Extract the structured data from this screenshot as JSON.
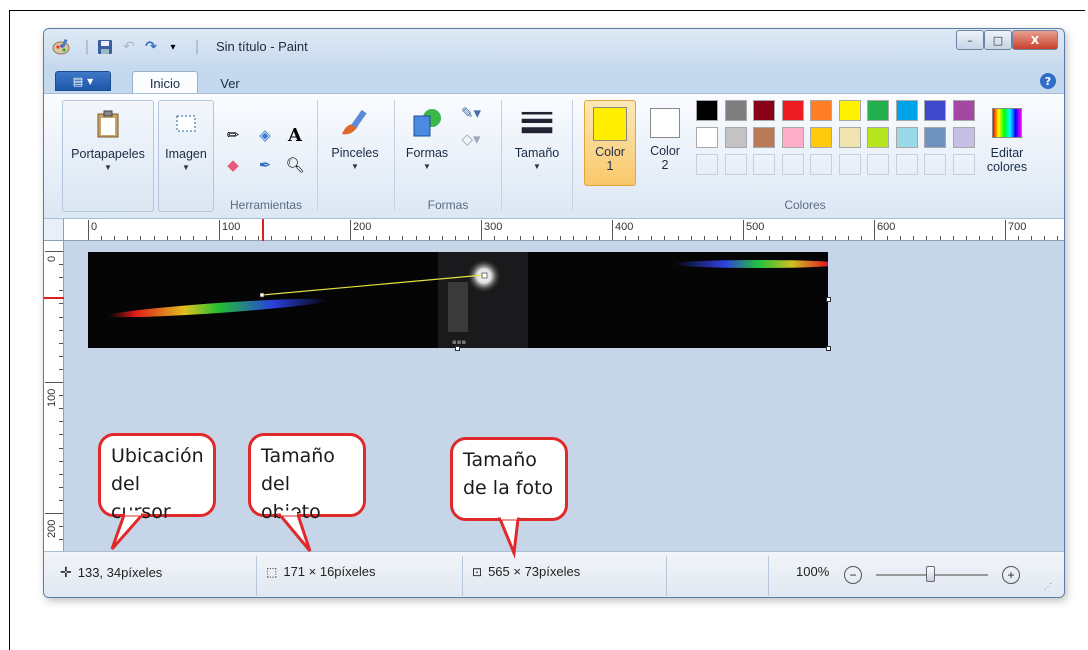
{
  "window": {
    "title": "Sin título - Paint",
    "controls": {
      "minimize": "–",
      "maximize": "□",
      "close": "X"
    }
  },
  "tabs": {
    "menu_icon": "menu-icon",
    "inicio": "Inicio",
    "ver": "Ver"
  },
  "ribbon": {
    "portapapeles": "Portapapeles",
    "imagen": "Imagen",
    "herramientas": "Herramientas",
    "pinceles": "Pinceles",
    "formas": "Formas",
    "formas_group": "Formas",
    "tamano": "Tamaño",
    "color1_line1": "Color",
    "color1_line2": "1",
    "color2_line1": "Color",
    "color2_line2": "2",
    "colores": "Colores",
    "editar_line1": "Editar",
    "editar_line2": "colores",
    "color1_value": "#ffee00",
    "color2_value": "#ffffff",
    "palette_row1": [
      "#000000",
      "#7f7f7f",
      "#880015",
      "#ed1c24",
      "#ff7f27",
      "#fff200",
      "#22b14c",
      "#00a2e8",
      "#3f48cc",
      "#a349a4"
    ],
    "palette_row2": [
      "#ffffff",
      "#c3c3c3",
      "#b97a57",
      "#ffaec9",
      "#ffc90e",
      "#efe4b0",
      "#b5e61d",
      "#99d9ea",
      "#7092be",
      "#c8bfe7"
    ]
  },
  "rulers": {
    "h_labels": [
      "0",
      "100",
      "200",
      "300",
      "400",
      "500",
      "600",
      "700"
    ],
    "v_labels": [
      "0",
      "100",
      "200"
    ]
  },
  "callouts": {
    "cursor": [
      "Ubicación",
      "del cursor"
    ],
    "objeto": [
      "Tamaño",
      "del objeto"
    ],
    "foto": [
      "Tamaño",
      "de la foto"
    ]
  },
  "status": {
    "cursor_pos": "133, 34píxeles",
    "selection_size": "171 × 16píxeles",
    "image_size": "565 × 73píxeles",
    "zoom": "100%",
    "zoom_level_percent": 100
  }
}
